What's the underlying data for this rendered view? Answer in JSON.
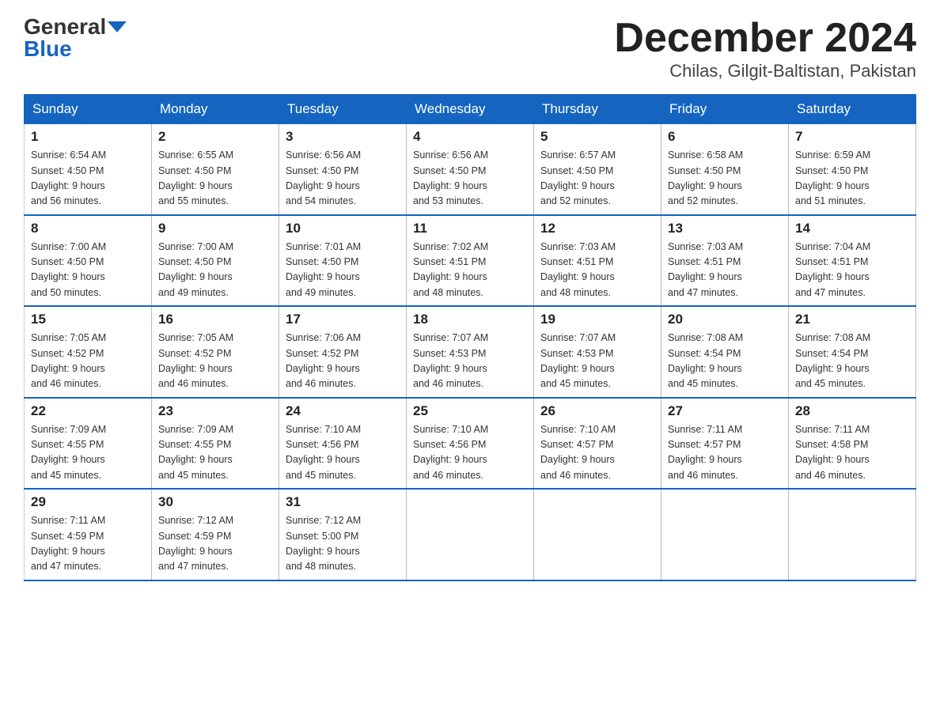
{
  "logo": {
    "general": "General",
    "blue": "Blue"
  },
  "title": "December 2024",
  "subtitle": "Chilas, Gilgit-Baltistan, Pakistan",
  "days_of_week": [
    "Sunday",
    "Monday",
    "Tuesday",
    "Wednesday",
    "Thursday",
    "Friday",
    "Saturday"
  ],
  "weeks": [
    [
      {
        "day": "1",
        "sunrise": "Sunrise: 6:54 AM",
        "sunset": "Sunset: 4:50 PM",
        "daylight": "Daylight: 9 hours",
        "minutes": "and 56 minutes."
      },
      {
        "day": "2",
        "sunrise": "Sunrise: 6:55 AM",
        "sunset": "Sunset: 4:50 PM",
        "daylight": "Daylight: 9 hours",
        "minutes": "and 55 minutes."
      },
      {
        "day": "3",
        "sunrise": "Sunrise: 6:56 AM",
        "sunset": "Sunset: 4:50 PM",
        "daylight": "Daylight: 9 hours",
        "minutes": "and 54 minutes."
      },
      {
        "day": "4",
        "sunrise": "Sunrise: 6:56 AM",
        "sunset": "Sunset: 4:50 PM",
        "daylight": "Daylight: 9 hours",
        "minutes": "and 53 minutes."
      },
      {
        "day": "5",
        "sunrise": "Sunrise: 6:57 AM",
        "sunset": "Sunset: 4:50 PM",
        "daylight": "Daylight: 9 hours",
        "minutes": "and 52 minutes."
      },
      {
        "day": "6",
        "sunrise": "Sunrise: 6:58 AM",
        "sunset": "Sunset: 4:50 PM",
        "daylight": "Daylight: 9 hours",
        "minutes": "and 52 minutes."
      },
      {
        "day": "7",
        "sunrise": "Sunrise: 6:59 AM",
        "sunset": "Sunset: 4:50 PM",
        "daylight": "Daylight: 9 hours",
        "minutes": "and 51 minutes."
      }
    ],
    [
      {
        "day": "8",
        "sunrise": "Sunrise: 7:00 AM",
        "sunset": "Sunset: 4:50 PM",
        "daylight": "Daylight: 9 hours",
        "minutes": "and 50 minutes."
      },
      {
        "day": "9",
        "sunrise": "Sunrise: 7:00 AM",
        "sunset": "Sunset: 4:50 PM",
        "daylight": "Daylight: 9 hours",
        "minutes": "and 49 minutes."
      },
      {
        "day": "10",
        "sunrise": "Sunrise: 7:01 AM",
        "sunset": "Sunset: 4:50 PM",
        "daylight": "Daylight: 9 hours",
        "minutes": "and 49 minutes."
      },
      {
        "day": "11",
        "sunrise": "Sunrise: 7:02 AM",
        "sunset": "Sunset: 4:51 PM",
        "daylight": "Daylight: 9 hours",
        "minutes": "and 48 minutes."
      },
      {
        "day": "12",
        "sunrise": "Sunrise: 7:03 AM",
        "sunset": "Sunset: 4:51 PM",
        "daylight": "Daylight: 9 hours",
        "minutes": "and 48 minutes."
      },
      {
        "day": "13",
        "sunrise": "Sunrise: 7:03 AM",
        "sunset": "Sunset: 4:51 PM",
        "daylight": "Daylight: 9 hours",
        "minutes": "and 47 minutes."
      },
      {
        "day": "14",
        "sunrise": "Sunrise: 7:04 AM",
        "sunset": "Sunset: 4:51 PM",
        "daylight": "Daylight: 9 hours",
        "minutes": "and 47 minutes."
      }
    ],
    [
      {
        "day": "15",
        "sunrise": "Sunrise: 7:05 AM",
        "sunset": "Sunset: 4:52 PM",
        "daylight": "Daylight: 9 hours",
        "minutes": "and 46 minutes."
      },
      {
        "day": "16",
        "sunrise": "Sunrise: 7:05 AM",
        "sunset": "Sunset: 4:52 PM",
        "daylight": "Daylight: 9 hours",
        "minutes": "and 46 minutes."
      },
      {
        "day": "17",
        "sunrise": "Sunrise: 7:06 AM",
        "sunset": "Sunset: 4:52 PM",
        "daylight": "Daylight: 9 hours",
        "minutes": "and 46 minutes."
      },
      {
        "day": "18",
        "sunrise": "Sunrise: 7:07 AM",
        "sunset": "Sunset: 4:53 PM",
        "daylight": "Daylight: 9 hours",
        "minutes": "and 46 minutes."
      },
      {
        "day": "19",
        "sunrise": "Sunrise: 7:07 AM",
        "sunset": "Sunset: 4:53 PM",
        "daylight": "Daylight: 9 hours",
        "minutes": "and 45 minutes."
      },
      {
        "day": "20",
        "sunrise": "Sunrise: 7:08 AM",
        "sunset": "Sunset: 4:54 PM",
        "daylight": "Daylight: 9 hours",
        "minutes": "and 45 minutes."
      },
      {
        "day": "21",
        "sunrise": "Sunrise: 7:08 AM",
        "sunset": "Sunset: 4:54 PM",
        "daylight": "Daylight: 9 hours",
        "minutes": "and 45 minutes."
      }
    ],
    [
      {
        "day": "22",
        "sunrise": "Sunrise: 7:09 AM",
        "sunset": "Sunset: 4:55 PM",
        "daylight": "Daylight: 9 hours",
        "minutes": "and 45 minutes."
      },
      {
        "day": "23",
        "sunrise": "Sunrise: 7:09 AM",
        "sunset": "Sunset: 4:55 PM",
        "daylight": "Daylight: 9 hours",
        "minutes": "and 45 minutes."
      },
      {
        "day": "24",
        "sunrise": "Sunrise: 7:10 AM",
        "sunset": "Sunset: 4:56 PM",
        "daylight": "Daylight: 9 hours",
        "minutes": "and 45 minutes."
      },
      {
        "day": "25",
        "sunrise": "Sunrise: 7:10 AM",
        "sunset": "Sunset: 4:56 PM",
        "daylight": "Daylight: 9 hours",
        "minutes": "and 46 minutes."
      },
      {
        "day": "26",
        "sunrise": "Sunrise: 7:10 AM",
        "sunset": "Sunset: 4:57 PM",
        "daylight": "Daylight: 9 hours",
        "minutes": "and 46 minutes."
      },
      {
        "day": "27",
        "sunrise": "Sunrise: 7:11 AM",
        "sunset": "Sunset: 4:57 PM",
        "daylight": "Daylight: 9 hours",
        "minutes": "and 46 minutes."
      },
      {
        "day": "28",
        "sunrise": "Sunrise: 7:11 AM",
        "sunset": "Sunset: 4:58 PM",
        "daylight": "Daylight: 9 hours",
        "minutes": "and 46 minutes."
      }
    ],
    [
      {
        "day": "29",
        "sunrise": "Sunrise: 7:11 AM",
        "sunset": "Sunset: 4:59 PM",
        "daylight": "Daylight: 9 hours",
        "minutes": "and 47 minutes."
      },
      {
        "day": "30",
        "sunrise": "Sunrise: 7:12 AM",
        "sunset": "Sunset: 4:59 PM",
        "daylight": "Daylight: 9 hours",
        "minutes": "and 47 minutes."
      },
      {
        "day": "31",
        "sunrise": "Sunrise: 7:12 AM",
        "sunset": "Sunset: 5:00 PM",
        "daylight": "Daylight: 9 hours",
        "minutes": "and 48 minutes."
      },
      null,
      null,
      null,
      null
    ]
  ]
}
